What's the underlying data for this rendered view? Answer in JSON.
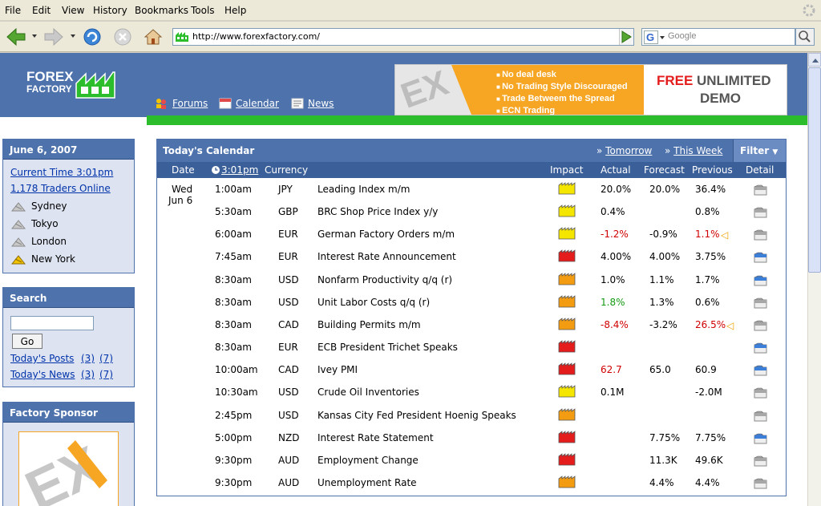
{
  "menu": [
    "File",
    "Edit",
    "View",
    "History",
    "Bookmarks",
    "Tools",
    "Help"
  ],
  "address": {
    "url": "http://www.forexfactory.com/"
  },
  "search": {
    "placeholder": "Google"
  },
  "header": {
    "logo_line1": "FOREX",
    "logo_line2": "FACTORY",
    "links": [
      "Forums",
      "Calendar",
      "News"
    ]
  },
  "banner": {
    "bullets": [
      "No deal desk",
      "No Trading Style Discouraged",
      "Trade Betweem the Spread",
      "ECN Trading"
    ],
    "free": "FREE",
    "unlimited": "UNLIMITED",
    "demo": "DEMO"
  },
  "sidebar": {
    "date_title": "June 6, 2007",
    "current_time": "Current Time 3:01pm",
    "traders_online": "1,178 Traders Online",
    "cities": [
      "Sydney",
      "Tokyo",
      "London",
      "New York"
    ],
    "search_title": "Search",
    "go_label": "Go",
    "posts_label": "Today's Posts",
    "posts_a": "(3)",
    "posts_b": "(7)",
    "news_label": "Today's News",
    "news_a": "(3)",
    "news_b": "(7)",
    "sponsor_title": "Factory Sponsor"
  },
  "calendar": {
    "title": "Today's Calendar",
    "tomorrow": "Tomorrow",
    "this_week": "This Week",
    "filter": "Filter",
    "columns": {
      "date": "Date",
      "time": "3:01pm",
      "currency": "Currency",
      "impact": "Impact",
      "actual": "Actual",
      "forecast": "Forecast",
      "previous": "Previous",
      "detail": "Detail"
    },
    "day": "Wed",
    "date": "Jun 6",
    "rows": [
      {
        "time": "1:00am",
        "cur": "JPY",
        "event": "Leading Index m/m",
        "impact": "low",
        "actual": "20.0%",
        "actual_color": "",
        "forecast": "20.0%",
        "previous": "36.4%",
        "prev_color": "",
        "detail": "gray"
      },
      {
        "time": "5:30am",
        "cur": "GBP",
        "event": "BRC Shop Price Index y/y",
        "impact": "low",
        "actual": "0.4%",
        "actual_color": "",
        "forecast": "",
        "previous": "0.8%",
        "prev_color": "",
        "detail": "gray"
      },
      {
        "time": "6:00am",
        "cur": "EUR",
        "event": "German Factory Orders m/m",
        "impact": "low",
        "actual": "-1.2%",
        "actual_color": "red",
        "forecast": "-0.9%",
        "previous": "1.1%",
        "prev_color": "red",
        "revised": true,
        "detail": "gray"
      },
      {
        "time": "7:45am",
        "cur": "EUR",
        "event": "Interest Rate Announcement",
        "impact": "high",
        "actual": "4.00%",
        "actual_color": "",
        "forecast": "4.00%",
        "previous": "3.75%",
        "prev_color": "",
        "detail": "blue"
      },
      {
        "time": "8:30am",
        "cur": "USD",
        "event": "Nonfarm Productivity q/q (r)",
        "impact": "medium",
        "actual": "1.0%",
        "actual_color": "",
        "forecast": "1.1%",
        "previous": "1.7%",
        "prev_color": "",
        "detail": "blue"
      },
      {
        "time": "8:30am",
        "cur": "USD",
        "event": "Unit Labor Costs q/q (r)",
        "impact": "medium",
        "actual": "1.8%",
        "actual_color": "green",
        "forecast": "1.3%",
        "previous": "0.6%",
        "prev_color": "",
        "detail": "gray"
      },
      {
        "time": "8:30am",
        "cur": "CAD",
        "event": "Building Permits m/m",
        "impact": "medium",
        "actual": "-8.4%",
        "actual_color": "red",
        "forecast": "-3.2%",
        "previous": "26.5%",
        "prev_color": "red",
        "revised": true,
        "detail": "gray"
      },
      {
        "time": "8:30am",
        "cur": "EUR",
        "event": "ECB President Trichet Speaks",
        "impact": "high",
        "actual": "",
        "actual_color": "",
        "forecast": "",
        "previous": "",
        "prev_color": "",
        "detail": "blue"
      },
      {
        "time": "10:00am",
        "cur": "CAD",
        "event": "Ivey PMI",
        "impact": "high",
        "actual": "62.7",
        "actual_color": "red",
        "forecast": "65.0",
        "previous": "60.9",
        "prev_color": "",
        "detail": "blue"
      },
      {
        "time": "10:30am",
        "cur": "USD",
        "event": "Crude Oil Inventories",
        "impact": "low",
        "actual": "0.1M",
        "actual_color": "",
        "forecast": "",
        "previous": "-2.0M",
        "prev_color": "",
        "detail": "gray"
      },
      {
        "time": "2:45pm",
        "cur": "USD",
        "event": "Kansas City Fed President Hoenig Speaks",
        "impact": "medium",
        "actual": "",
        "actual_color": "",
        "forecast": "",
        "previous": "",
        "prev_color": "",
        "detail": "gray"
      },
      {
        "time": "5:00pm",
        "cur": "NZD",
        "event": "Interest Rate Statement",
        "impact": "high",
        "actual": "",
        "actual_color": "",
        "forecast": "7.75%",
        "previous": "7.75%",
        "prev_color": "",
        "detail": "blue"
      },
      {
        "time": "9:30pm",
        "cur": "AUD",
        "event": "Employment Change",
        "impact": "high",
        "actual": "",
        "actual_color": "",
        "forecast": "11.3K",
        "previous": "49.6K",
        "prev_color": "",
        "detail": "gray"
      },
      {
        "time": "9:30pm",
        "cur": "AUD",
        "event": "Unemployment Rate",
        "impact": "medium",
        "actual": "",
        "actual_color": "",
        "forecast": "4.4%",
        "previous": "4.4%",
        "prev_color": "",
        "detail": "gray"
      }
    ]
  },
  "colors": {
    "brand_blue": "#4d72ac",
    "brand_green": "#2bbd2b",
    "impact_low": "#f5e600",
    "impact_medium": "#f39c12",
    "impact_high": "#e41c1c"
  }
}
